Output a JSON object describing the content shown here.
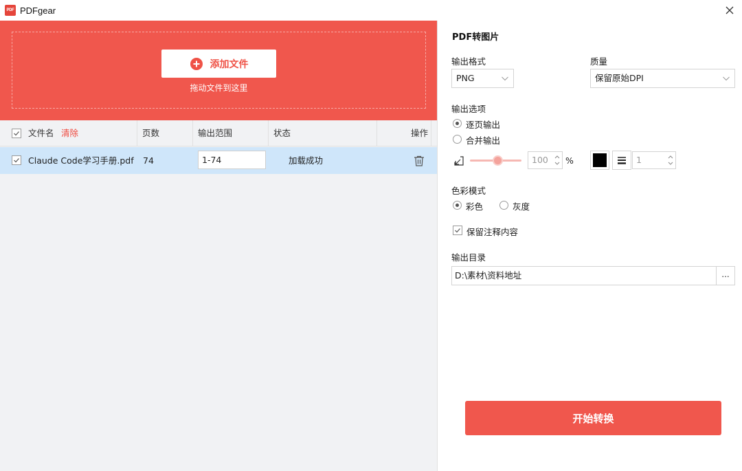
{
  "window": {
    "logo_text": "PDF",
    "title": "PDFgear"
  },
  "dropzone": {
    "add_label": "添加文件",
    "hint": "拖动文件到这里"
  },
  "table": {
    "columns": {
      "name": "文件名",
      "clear": "清除",
      "pages": "页数",
      "range": "输出范围",
      "status": "状态",
      "action": "操作"
    },
    "rows": [
      {
        "checked": true,
        "name": "Claude Code学习手册.pdf",
        "pages": "74",
        "range": "1-74",
        "status": "加载成功"
      }
    ]
  },
  "settings": {
    "title": "PDF转图片",
    "format_label": "输出格式",
    "format_value": "PNG",
    "quality_label": "质量",
    "quality_value": "保留原始DPI",
    "output_options_label": "输出选项",
    "options": [
      {
        "label": "逐页输出",
        "selected": true
      },
      {
        "label": "合并输出",
        "selected": false
      }
    ],
    "scale_value": "100",
    "scale_unit": "%",
    "border_color": "#000000",
    "border_width": "1",
    "color_mode_label": "色彩模式",
    "color_modes": [
      {
        "label": "彩色",
        "selected": true
      },
      {
        "label": "灰度",
        "selected": false
      }
    ],
    "keep_annotations_label": "保留注释内容",
    "keep_annotations": true,
    "output_dir_label": "输出目录",
    "output_dir_value": "D:\\素材\\资料地址",
    "browse_label": "...",
    "start_label": "开始转换"
  },
  "colors": {
    "accent": "#f0574d",
    "selected_row": "#cfe6fa",
    "panel_bg": "#f1f2f4"
  }
}
